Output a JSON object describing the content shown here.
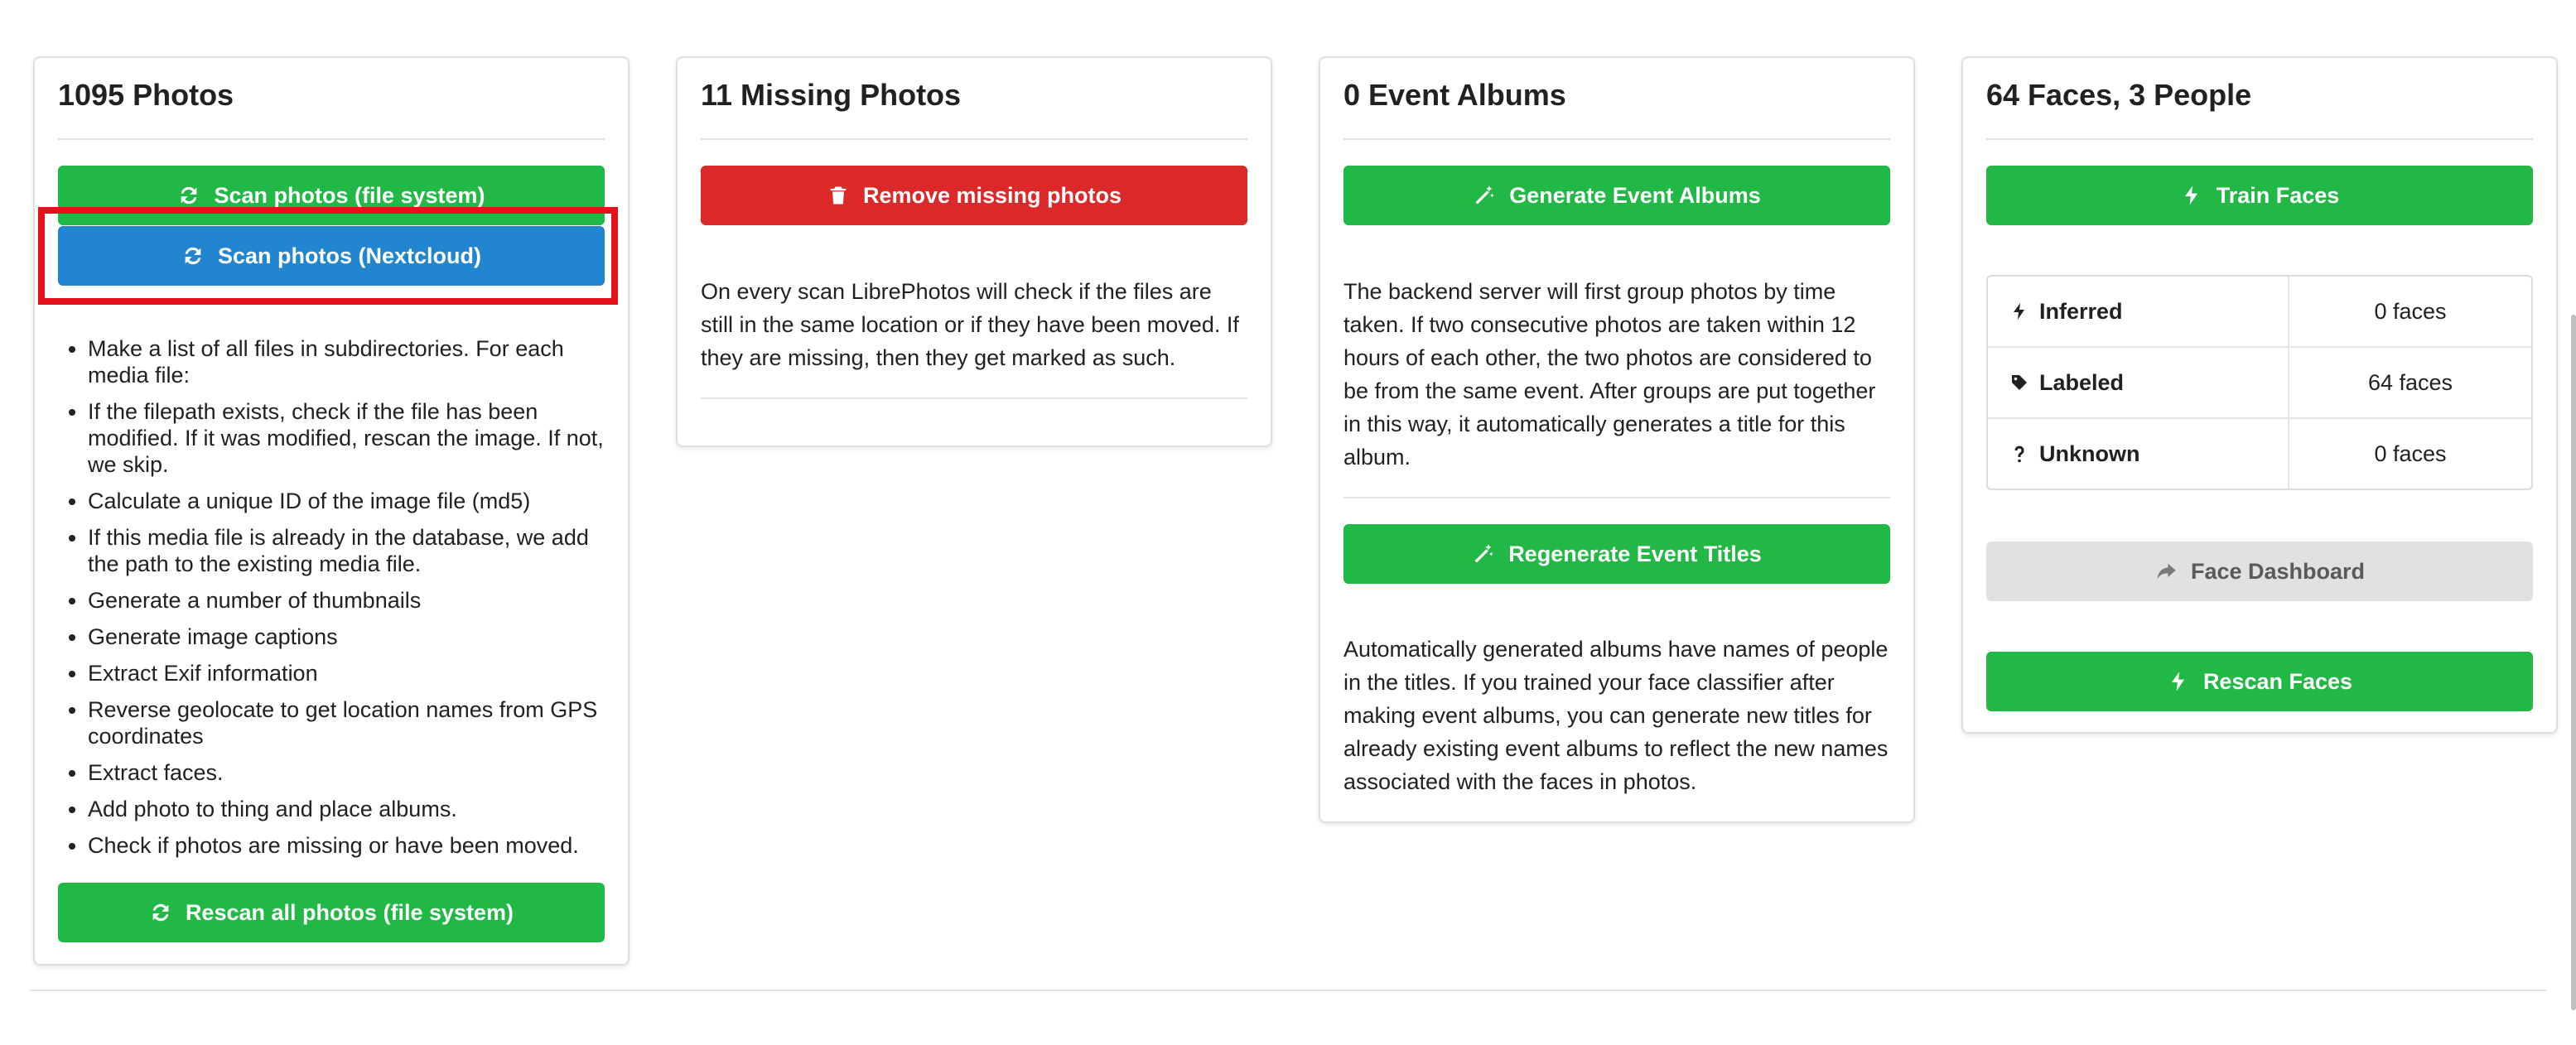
{
  "colors": {
    "green": "#21b845",
    "blue": "#2185d0",
    "red": "#db2828",
    "grey": "#e0e1e2",
    "highlight": "#e3121a"
  },
  "photos_card": {
    "title": "1095 Photos",
    "scan_fs_label": "Scan photos (file system)",
    "scan_nextcloud_label": "Scan photos (Nextcloud)",
    "steps": [
      "Make a list of all files in subdirectories. For each media file:",
      "If the filepath exists, check if the file has been modified. If it was modified, rescan the image. If not, we skip.",
      "Calculate a unique ID of the image file (md5)",
      "If this media file is already in the database, we add the path to the existing media file.",
      "Generate a number of thumbnails",
      "Generate image captions",
      "Extract Exif information",
      "Reverse geolocate to get location names from GPS coordinates",
      "Extract faces.",
      "Add photo to thing and place albums.",
      "Check if photos are missing or have been moved."
    ],
    "rescan_all_label": "Rescan all photos (file system)"
  },
  "missing_card": {
    "title": "11 Missing Photos",
    "remove_label": "Remove missing photos",
    "description": "On every scan LibrePhotos will check if the files are still in the same location or if they have been moved. If they are missing, then they get marked as such."
  },
  "events_card": {
    "title": "0 Event Albums",
    "generate_label": "Generate Event Albums",
    "generate_description": "The backend server will first group photos by time taken. If two consecutive photos are taken within 12 hours of each other, the two photos are considered to be from the same event. After groups are put together in this way, it automatically generates a title for this album.",
    "regenerate_label": "Regenerate Event Titles",
    "regenerate_description": "Automatically generated albums have names of people in the titles. If you trained your face classifier after making event albums, you can generate new titles for already existing event albums to reflect the new names associated with the faces in photos."
  },
  "faces_card": {
    "title": "64 Faces, 3 People",
    "train_label": "Train Faces",
    "rows": [
      {
        "label": "Inferred",
        "value": "0 faces",
        "icon": "bolt-icon"
      },
      {
        "label": "Labeled",
        "value": "64 faces",
        "icon": "tag-icon"
      },
      {
        "label": "Unknown",
        "value": "0 faces",
        "icon": "question-icon"
      }
    ],
    "dashboard_label": "Face Dashboard",
    "rescan_label": "Rescan Faces"
  }
}
